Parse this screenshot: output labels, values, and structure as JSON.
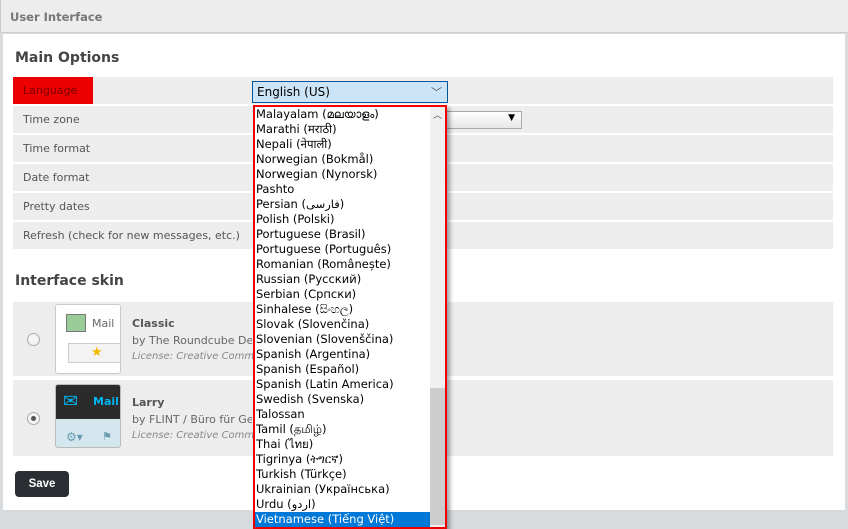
{
  "header": {
    "title": "User Interface"
  },
  "main_options": {
    "title": "Main Options",
    "rows": [
      {
        "label": "Language"
      },
      {
        "label": "Time zone"
      },
      {
        "label": "Time format"
      },
      {
        "label": "Date format"
      },
      {
        "label": "Pretty dates"
      },
      {
        "label": "Refresh (check for new messages, etc.)"
      }
    ],
    "language_value": "English (US)"
  },
  "language_list": [
    "Malayalam (മലയാളം)",
    "Marathi (मराठी)",
    "Nepali (नेपाली)",
    "Norwegian (Bokmål)",
    "Norwegian (Nynorsk)",
    "Pashto",
    "Persian (فارسی)",
    "Polish (Polski)",
    "Portuguese (Brasil)",
    "Portuguese (Português)",
    "Romanian (Românește)",
    "Russian (Русский)",
    "Serbian (Српски)",
    "Sinhalese (සිංහල)",
    "Slovak (Slovenčina)",
    "Slovenian (Slovenščina)",
    "Spanish (Argentina)",
    "Spanish (Español)",
    "Spanish (Latin America)",
    "Swedish (Svenska)",
    "Talossan",
    "Tamil (தமிழ்)",
    "Thai (ไทย)",
    "Tigrinya (ትግርኛ)",
    "Turkish (Türkçe)",
    "Ukrainian (Українська)",
    "Urdu (اردو)",
    "Vietnamese (Tiếng Việt)"
  ],
  "selected_index": 27,
  "skins": {
    "title": "Interface skin",
    "items": [
      {
        "name": "Classic",
        "author": "by The Roundcube Dev Team",
        "license": "License: Creative Commons",
        "thumb_label": "Mail",
        "selected": false
      },
      {
        "name": "Larry",
        "author": "by FLINT / Büro für Gestaltung",
        "license": "License: Creative Commons",
        "thumb_label": "Mail",
        "selected": true
      }
    ]
  },
  "save_label": "Save"
}
